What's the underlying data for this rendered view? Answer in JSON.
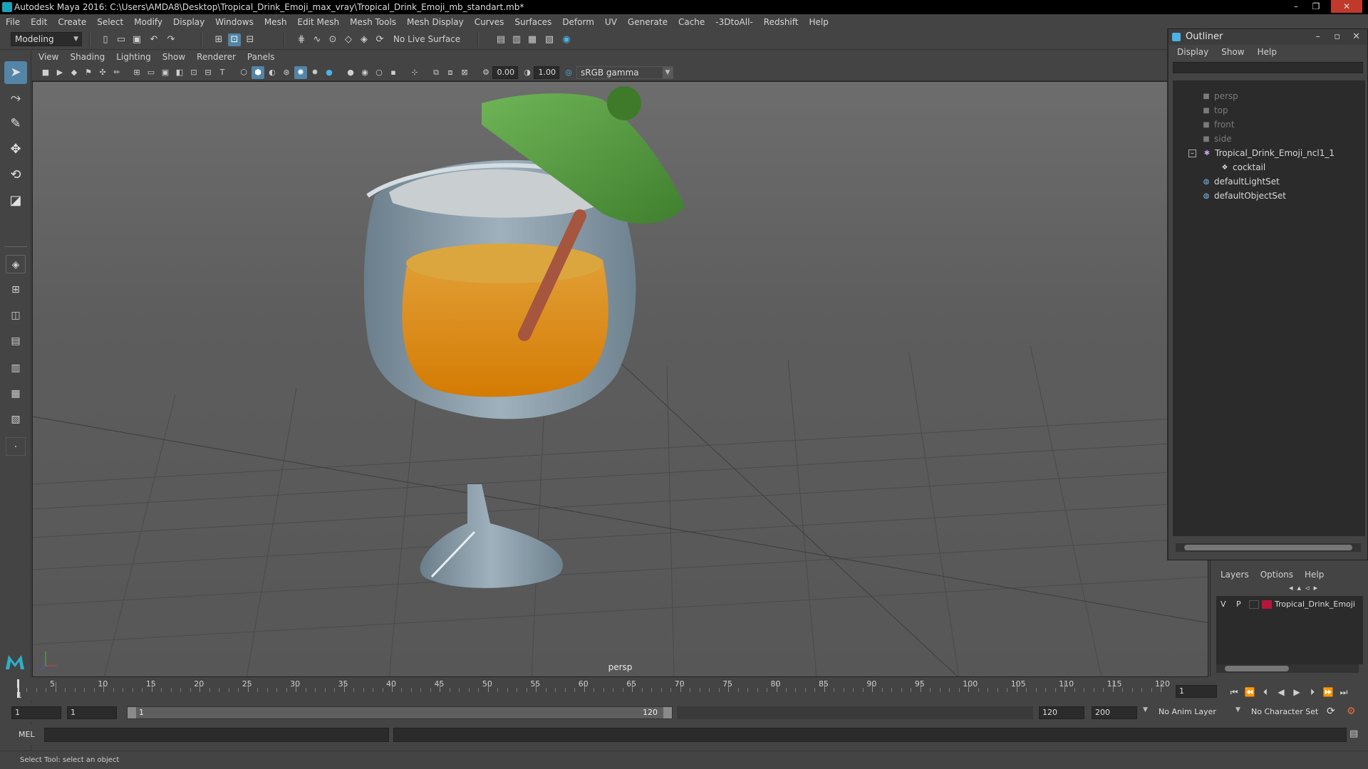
{
  "window": {
    "title": "Autodesk Maya 2016: C:\\Users\\AMDA8\\Desktop\\Tropical_Drink_Emoji_max_vray\\Tropical_Drink_Emoji_mb_standart.mb*",
    "minimize": "–",
    "restore": "❐",
    "close": "✕"
  },
  "menubar": [
    "File",
    "Edit",
    "Create",
    "Select",
    "Modify",
    "Display",
    "Windows",
    "Mesh",
    "Edit Mesh",
    "Mesh Tools",
    "Mesh Display",
    "Curves",
    "Surfaces",
    "Deform",
    "UV",
    "Generate",
    "Cache",
    "-3DtoAll-",
    "Redshift",
    "Help"
  ],
  "statusline": {
    "mode": "Modeling",
    "live_surface": "No Live Surface"
  },
  "viewport": {
    "menu": [
      "View",
      "Shading",
      "Lighting",
      "Show",
      "Renderer",
      "Panels"
    ],
    "exposure": "0.00",
    "gamma": "1.00",
    "color_space": "sRGB gamma",
    "camera_label": "persp"
  },
  "outliner": {
    "title": "Outliner",
    "menu": [
      "Display",
      "Show",
      "Help"
    ],
    "items": [
      {
        "label": "persp",
        "icon": "camera-icon"
      },
      {
        "label": "top",
        "icon": "camera-icon"
      },
      {
        "label": "front",
        "icon": "camera-icon"
      },
      {
        "label": "side",
        "icon": "camera-icon"
      },
      {
        "label": "Tropical_Drink_Emoji_ncl1_1",
        "icon": "group-icon"
      },
      {
        "label": "cocktail",
        "icon": "mesh-icon"
      },
      {
        "label": "defaultLightSet",
        "icon": "set-icon"
      },
      {
        "label": "defaultObjectSet",
        "icon": "set-icon"
      }
    ]
  },
  "layers": {
    "menu": [
      "Layers",
      "Options",
      "Help"
    ],
    "row": {
      "v": "V",
      "p": "P",
      "name": "Tropical_Drink_Emoji",
      "color": "#b5173a"
    }
  },
  "timeline": {
    "ticks": [
      "5",
      "10",
      "15",
      "20",
      "25",
      "30",
      "35",
      "40",
      "45",
      "50",
      "55",
      "60",
      "65",
      "70",
      "75",
      "80",
      "85",
      "90",
      "95",
      "100",
      "105",
      "110",
      "115",
      "120"
    ],
    "first_tick": "1",
    "current_frame": "1"
  },
  "range": {
    "start": "1",
    "playback_start": "1",
    "slider_start": "1",
    "slider_end": "120",
    "playback_end": "120",
    "end": "200",
    "anim_layer": "No Anim Layer",
    "character_set": "No Character Set"
  },
  "command": {
    "label": "MEL"
  },
  "help": {
    "text": "Select Tool: select an object"
  },
  "colors": {
    "accent": "#5285a6",
    "umbrella": "#4f9a3a",
    "drink": "#d9820b",
    "glass": "#8c9fab"
  }
}
